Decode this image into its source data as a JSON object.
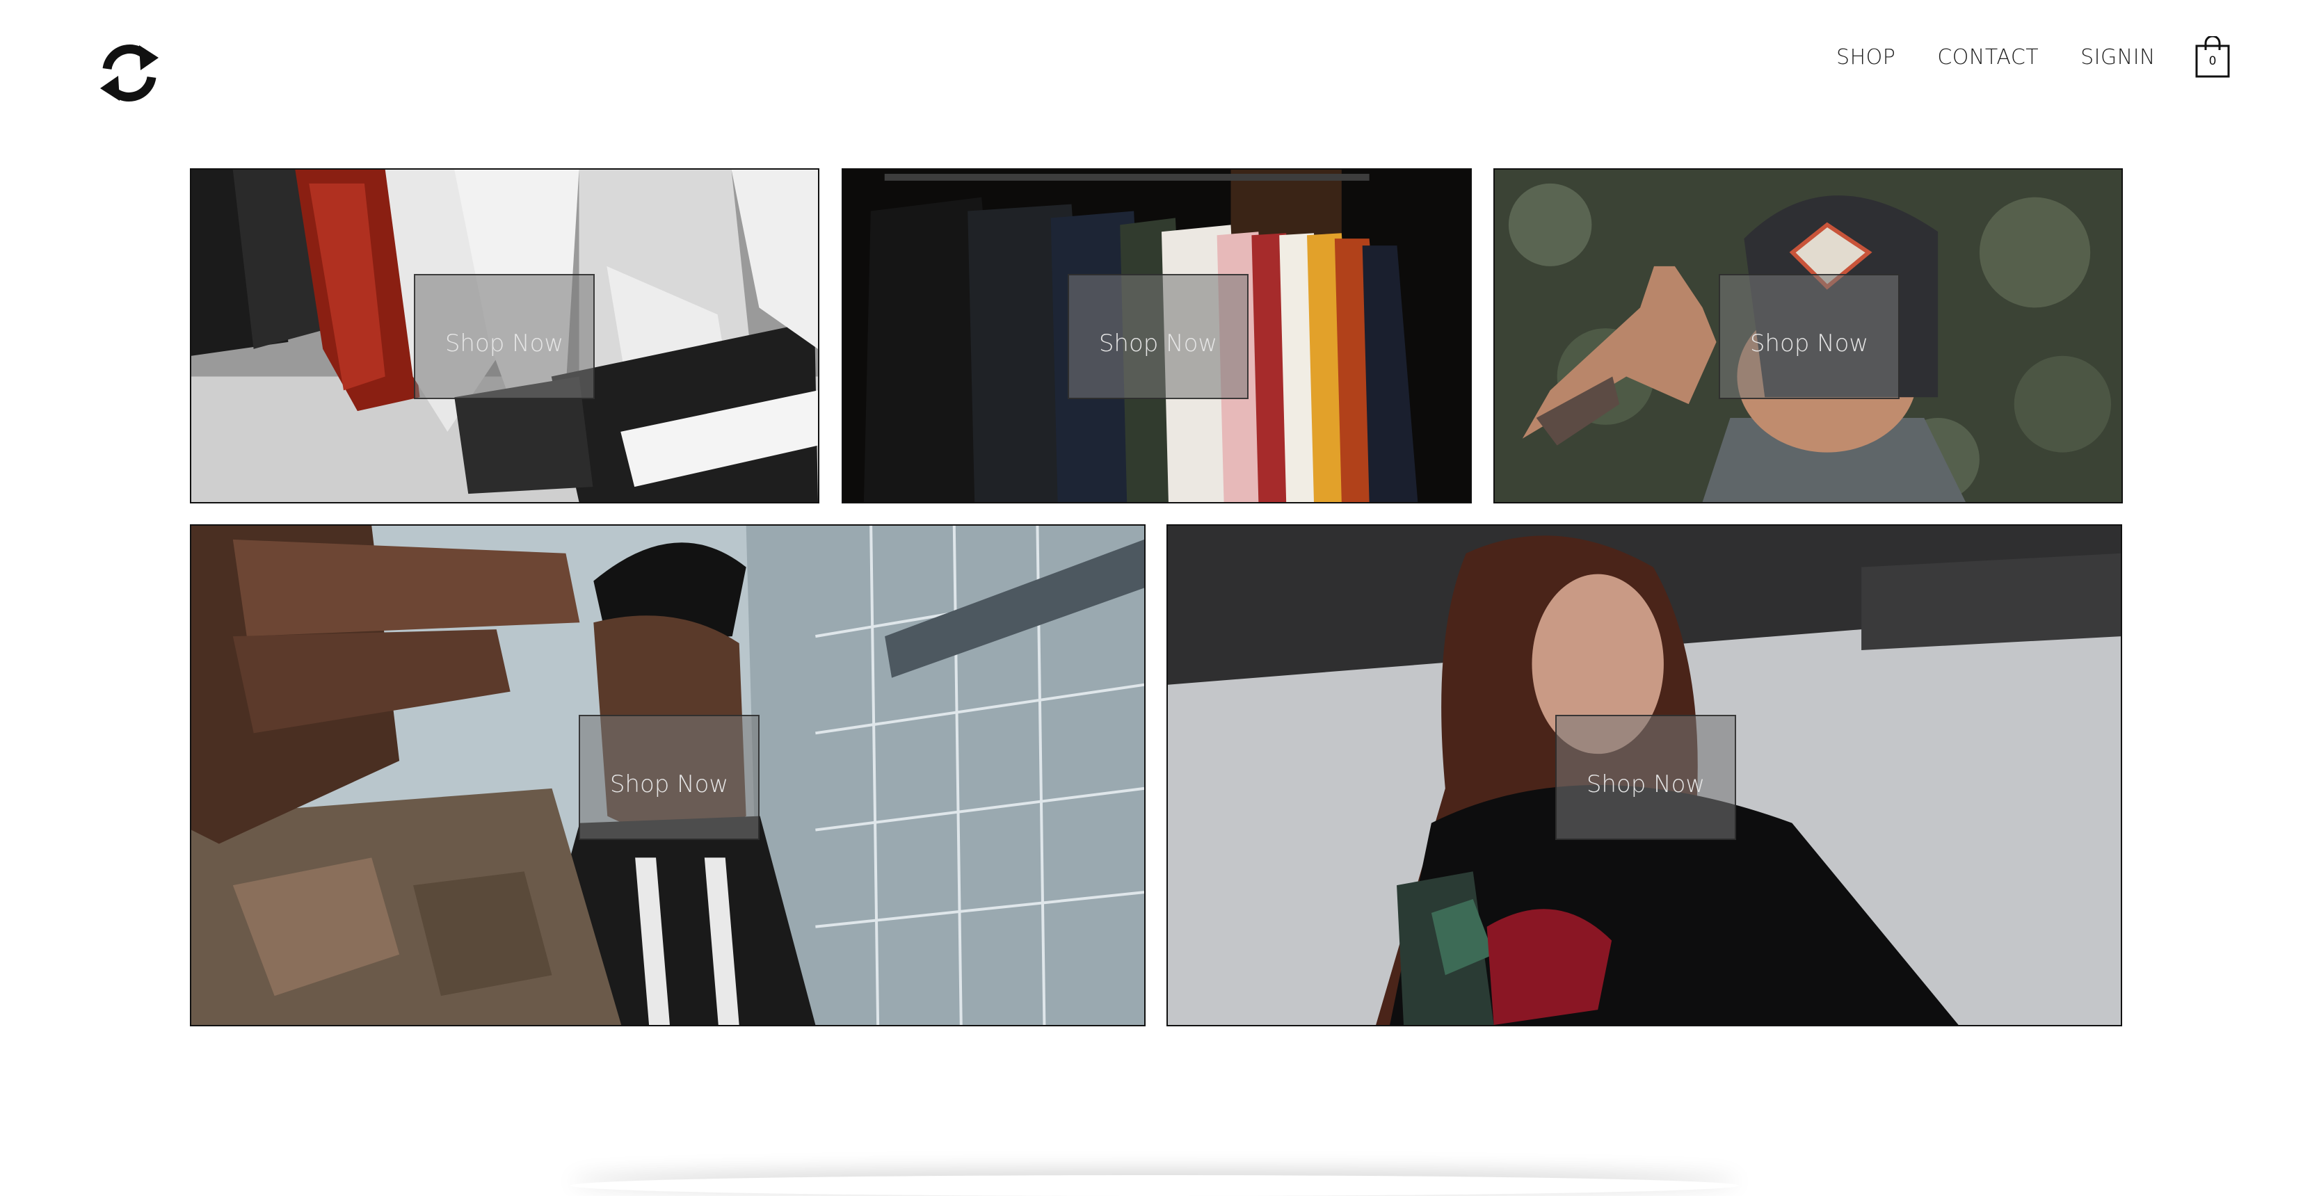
{
  "header": {
    "logo_icon": "refresh-arrows-logo",
    "nav": [
      {
        "label": "SHOP"
      },
      {
        "label": "CONTACT"
      },
      {
        "label": "SIGNIN"
      }
    ],
    "cart": {
      "icon": "shopping-bag-icon",
      "count": "0"
    }
  },
  "tiles": [
    {
      "subject": "sneakers",
      "cta": "Shop Now"
    },
    {
      "subject": "clothing-rack",
      "cta": "Shop Now"
    },
    {
      "subject": "cap",
      "cta": "Shop Now"
    },
    {
      "subject": "man-reaching",
      "cta": "Shop Now"
    },
    {
      "subject": "woman-hoodie",
      "cta": "Shop Now"
    }
  ]
}
